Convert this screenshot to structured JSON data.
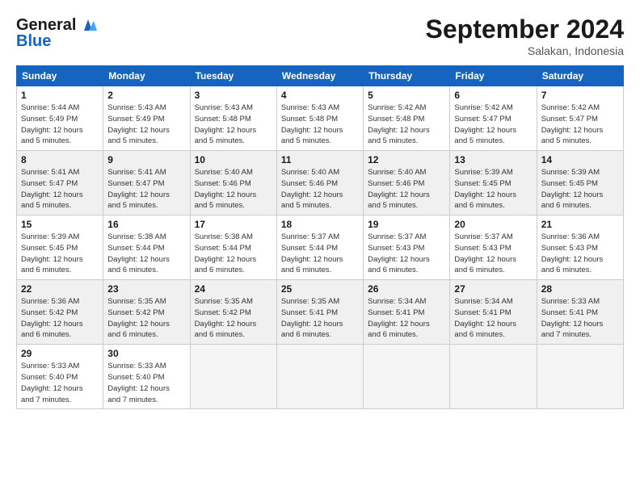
{
  "header": {
    "logo_text_general": "General",
    "logo_text_blue": "Blue",
    "month_title": "September 2024",
    "location": "Salakan, Indonesia"
  },
  "days_of_week": [
    "Sunday",
    "Monday",
    "Tuesday",
    "Wednesday",
    "Thursday",
    "Friday",
    "Saturday"
  ],
  "weeks": [
    {
      "shaded": false,
      "days": [
        {
          "num": "1",
          "info": [
            "Sunrise: 5:44 AM",
            "Sunset: 5:49 PM",
            "Daylight: 12 hours",
            "and 5 minutes."
          ]
        },
        {
          "num": "2",
          "info": [
            "Sunrise: 5:43 AM",
            "Sunset: 5:49 PM",
            "Daylight: 12 hours",
            "and 5 minutes."
          ]
        },
        {
          "num": "3",
          "info": [
            "Sunrise: 5:43 AM",
            "Sunset: 5:48 PM",
            "Daylight: 12 hours",
            "and 5 minutes."
          ]
        },
        {
          "num": "4",
          "info": [
            "Sunrise: 5:43 AM",
            "Sunset: 5:48 PM",
            "Daylight: 12 hours",
            "and 5 minutes."
          ]
        },
        {
          "num": "5",
          "info": [
            "Sunrise: 5:42 AM",
            "Sunset: 5:48 PM",
            "Daylight: 12 hours",
            "and 5 minutes."
          ]
        },
        {
          "num": "6",
          "info": [
            "Sunrise: 5:42 AM",
            "Sunset: 5:47 PM",
            "Daylight: 12 hours",
            "and 5 minutes."
          ]
        },
        {
          "num": "7",
          "info": [
            "Sunrise: 5:42 AM",
            "Sunset: 5:47 PM",
            "Daylight: 12 hours",
            "and 5 minutes."
          ]
        }
      ]
    },
    {
      "shaded": true,
      "days": [
        {
          "num": "8",
          "info": [
            "Sunrise: 5:41 AM",
            "Sunset: 5:47 PM",
            "Daylight: 12 hours",
            "and 5 minutes."
          ]
        },
        {
          "num": "9",
          "info": [
            "Sunrise: 5:41 AM",
            "Sunset: 5:47 PM",
            "Daylight: 12 hours",
            "and 5 minutes."
          ]
        },
        {
          "num": "10",
          "info": [
            "Sunrise: 5:40 AM",
            "Sunset: 5:46 PM",
            "Daylight: 12 hours",
            "and 5 minutes."
          ]
        },
        {
          "num": "11",
          "info": [
            "Sunrise: 5:40 AM",
            "Sunset: 5:46 PM",
            "Daylight: 12 hours",
            "and 5 minutes."
          ]
        },
        {
          "num": "12",
          "info": [
            "Sunrise: 5:40 AM",
            "Sunset: 5:46 PM",
            "Daylight: 12 hours",
            "and 5 minutes."
          ]
        },
        {
          "num": "13",
          "info": [
            "Sunrise: 5:39 AM",
            "Sunset: 5:45 PM",
            "Daylight: 12 hours",
            "and 6 minutes."
          ]
        },
        {
          "num": "14",
          "info": [
            "Sunrise: 5:39 AM",
            "Sunset: 5:45 PM",
            "Daylight: 12 hours",
            "and 6 minutes."
          ]
        }
      ]
    },
    {
      "shaded": false,
      "days": [
        {
          "num": "15",
          "info": [
            "Sunrise: 5:39 AM",
            "Sunset: 5:45 PM",
            "Daylight: 12 hours",
            "and 6 minutes."
          ]
        },
        {
          "num": "16",
          "info": [
            "Sunrise: 5:38 AM",
            "Sunset: 5:44 PM",
            "Daylight: 12 hours",
            "and 6 minutes."
          ]
        },
        {
          "num": "17",
          "info": [
            "Sunrise: 5:38 AM",
            "Sunset: 5:44 PM",
            "Daylight: 12 hours",
            "and 6 minutes."
          ]
        },
        {
          "num": "18",
          "info": [
            "Sunrise: 5:37 AM",
            "Sunset: 5:44 PM",
            "Daylight: 12 hours",
            "and 6 minutes."
          ]
        },
        {
          "num": "19",
          "info": [
            "Sunrise: 5:37 AM",
            "Sunset: 5:43 PM",
            "Daylight: 12 hours",
            "and 6 minutes."
          ]
        },
        {
          "num": "20",
          "info": [
            "Sunrise: 5:37 AM",
            "Sunset: 5:43 PM",
            "Daylight: 12 hours",
            "and 6 minutes."
          ]
        },
        {
          "num": "21",
          "info": [
            "Sunrise: 5:36 AM",
            "Sunset: 5:43 PM",
            "Daylight: 12 hours",
            "and 6 minutes."
          ]
        }
      ]
    },
    {
      "shaded": true,
      "days": [
        {
          "num": "22",
          "info": [
            "Sunrise: 5:36 AM",
            "Sunset: 5:42 PM",
            "Daylight: 12 hours",
            "and 6 minutes."
          ]
        },
        {
          "num": "23",
          "info": [
            "Sunrise: 5:35 AM",
            "Sunset: 5:42 PM",
            "Daylight: 12 hours",
            "and 6 minutes."
          ]
        },
        {
          "num": "24",
          "info": [
            "Sunrise: 5:35 AM",
            "Sunset: 5:42 PM",
            "Daylight: 12 hours",
            "and 6 minutes."
          ]
        },
        {
          "num": "25",
          "info": [
            "Sunrise: 5:35 AM",
            "Sunset: 5:41 PM",
            "Daylight: 12 hours",
            "and 6 minutes."
          ]
        },
        {
          "num": "26",
          "info": [
            "Sunrise: 5:34 AM",
            "Sunset: 5:41 PM",
            "Daylight: 12 hours",
            "and 6 minutes."
          ]
        },
        {
          "num": "27",
          "info": [
            "Sunrise: 5:34 AM",
            "Sunset: 5:41 PM",
            "Daylight: 12 hours",
            "and 6 minutes."
          ]
        },
        {
          "num": "28",
          "info": [
            "Sunrise: 5:33 AM",
            "Sunset: 5:41 PM",
            "Daylight: 12 hours",
            "and 7 minutes."
          ]
        }
      ]
    },
    {
      "shaded": false,
      "days": [
        {
          "num": "29",
          "info": [
            "Sunrise: 5:33 AM",
            "Sunset: 5:40 PM",
            "Daylight: 12 hours",
            "and 7 minutes."
          ]
        },
        {
          "num": "30",
          "info": [
            "Sunrise: 5:33 AM",
            "Sunset: 5:40 PM",
            "Daylight: 12 hours",
            "and 7 minutes."
          ]
        },
        {
          "num": "",
          "info": []
        },
        {
          "num": "",
          "info": []
        },
        {
          "num": "",
          "info": []
        },
        {
          "num": "",
          "info": []
        },
        {
          "num": "",
          "info": []
        }
      ]
    }
  ]
}
